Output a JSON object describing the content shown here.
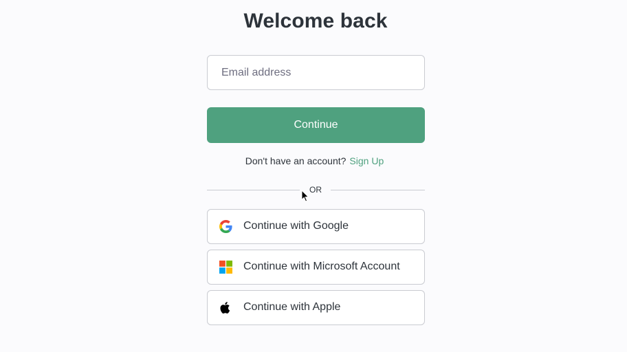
{
  "header": {
    "title": "Welcome back"
  },
  "form": {
    "email_placeholder": "Email address",
    "email_value": "",
    "continue_label": "Continue"
  },
  "signup": {
    "prompt": "Don't have an account?",
    "link_label": "Sign Up"
  },
  "divider": {
    "label": "OR"
  },
  "social": {
    "google_label": "Continue with Google",
    "microsoft_label": "Continue with Microsoft Account",
    "apple_label": "Continue with Apple"
  },
  "icons": {
    "google": "google-logo-icon",
    "microsoft": "microsoft-logo-icon",
    "apple": "apple-logo-icon",
    "cursor": "mouse-pointer-icon"
  },
  "colors": {
    "accent": "#4fa17f",
    "text": "#2d333a",
    "border": "#c9cbd1",
    "background": "#fbfbfd"
  }
}
